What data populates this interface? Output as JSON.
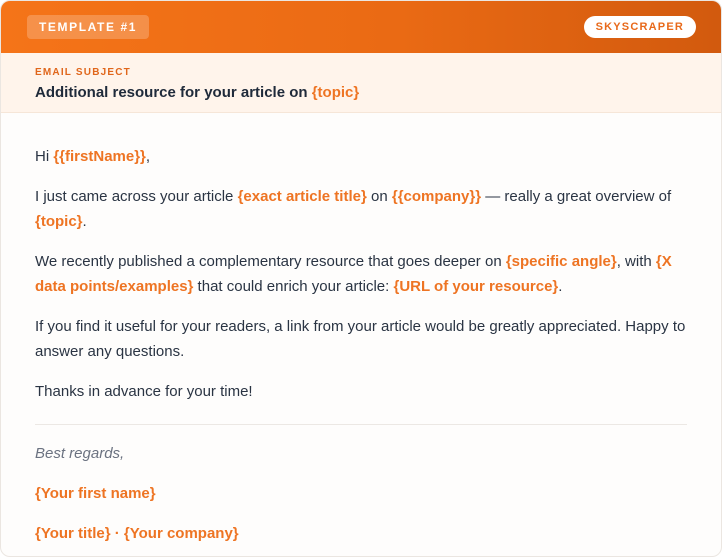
{
  "header": {
    "template_label": "TEMPLATE #1",
    "type_badge": "SKYSCRAPER"
  },
  "subject": {
    "label": "EMAIL SUBJECT",
    "text": "Additional resource for your article on ",
    "placeholder": "{topic}"
  },
  "body": {
    "greeting": {
      "prefix": "Hi ",
      "name": "{{firstName}}",
      "suffix": ","
    },
    "para1": {
      "t1": "I just came across your article ",
      "p1": "{exact article title}",
      "t2": " on ",
      "p2": "{{company}}",
      "t3": " — really a great overview of ",
      "p3": "{topic}",
      "t4": "."
    },
    "para2": {
      "t1": "We recently published a complementary resource that goes deeper on ",
      "p1": "{specific angle}",
      "t2": ", with ",
      "p2": "{X data points/examples}",
      "t3": " that could enrich your article: ",
      "p3": "{URL of your resource}",
      "t4": "."
    },
    "para3": "If you find it useful for your readers, a link from your article would be greatly appreciated. Happy to answer any questions.",
    "para4": "Thanks in advance for your time!"
  },
  "signature": {
    "closing": "Best regards,",
    "name": "{Your first name}",
    "title_company": "{Your title} · {Your company}"
  },
  "colors": {
    "accent": "#ee7423",
    "header_start": "#f57418",
    "header_end": "#d25a0e",
    "subject_bg": "#fff4eb",
    "text": "#2a3443"
  }
}
